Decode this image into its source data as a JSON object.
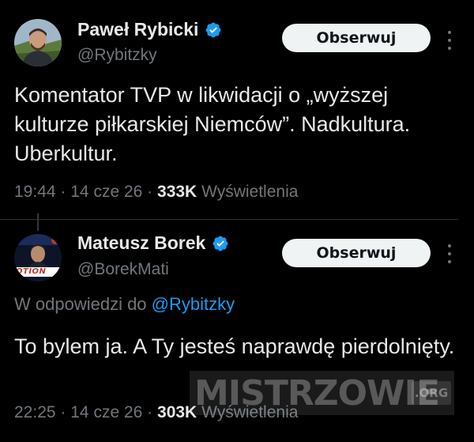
{
  "tweets": [
    {
      "author_name": "Paweł Rybicki",
      "handle": "@Rybitzky",
      "follow_label": "Obserwuj",
      "text": "Komentator TVP w likwidacji o „wyższej kulturze piłkarskiej Niemców”. Nadkultura. Uberkultur.",
      "time": "19:44",
      "date": "14 cze 26",
      "views_count": "333K",
      "views_label": "Wyświetlenia"
    },
    {
      "author_name": "Mateusz Borek",
      "handle": "@BorekMati",
      "follow_label": "Obserwuj",
      "reply_prefix": "W odpowiedzi do",
      "reply_mention": "@Rybitzky",
      "text": "To bylem ja. A Ty jesteś naprawdę pierdolnięty.",
      "avatar_text": "OTION",
      "time": "22:25",
      "date": "14 cze 26",
      "views_count": "303K",
      "views_label": "Wyświetlenia"
    }
  ],
  "separator": "·",
  "watermark": {
    "text": "MISTRZOWIE",
    "tld": ".ORG"
  },
  "colors": {
    "background": "#000000",
    "text": "#e7e9ea",
    "secondary": "#71767b",
    "accent": "#1d9bf0",
    "button_bg": "#eff3f4"
  },
  "icons": {
    "verified": "verified-badge-icon",
    "more": "more-dots-icon"
  }
}
